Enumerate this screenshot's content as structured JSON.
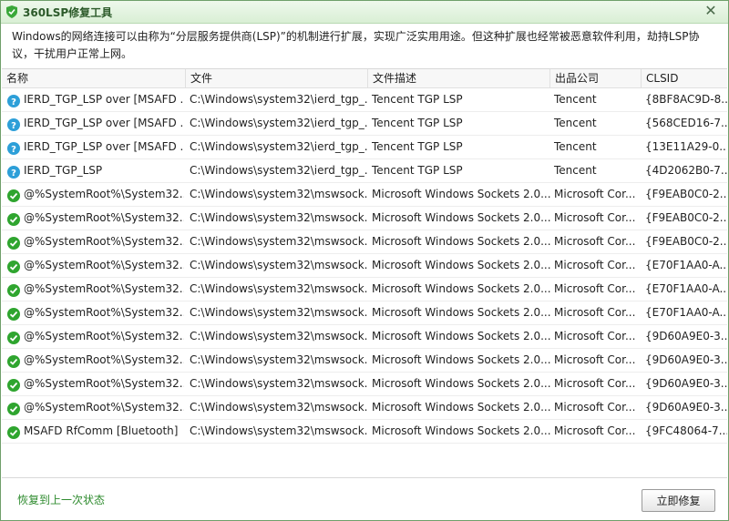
{
  "window": {
    "title": "360LSP修复工具",
    "close_label": "✕"
  },
  "description": "Windows的网络连接可以由称为“分层服务提供商(LSP)”的机制进行扩展，实现广泛实用用途。但这种扩展也经常被恶意软件利用，劫持LSP协议，干扰用户正常上网。",
  "columns": [
    "名称",
    "文件",
    "文件描述",
    "出品公司",
    "CLSID"
  ],
  "rows": [
    {
      "status": "info",
      "name": "IERD_TGP_LSP over [MSAFD ...",
      "file": "C:\\Windows\\system32\\ierd_tgp_...",
      "desc": "Tencent TGP LSP",
      "company": "Tencent",
      "clsid": "{8BF8AC9D-8..."
    },
    {
      "status": "info",
      "name": "IERD_TGP_LSP over [MSAFD ...",
      "file": "C:\\Windows\\system32\\ierd_tgp_...",
      "desc": "Tencent TGP LSP",
      "company": "Tencent",
      "clsid": "{568CED16-7..."
    },
    {
      "status": "info",
      "name": "IERD_TGP_LSP over [MSAFD ...",
      "file": "C:\\Windows\\system32\\ierd_tgp_...",
      "desc": "Tencent TGP LSP",
      "company": "Tencent",
      "clsid": "{13E11A29-0..."
    },
    {
      "status": "info",
      "name": "IERD_TGP_LSP",
      "file": "C:\\Windows\\system32\\ierd_tgp_...",
      "desc": "Tencent TGP LSP",
      "company": "Tencent",
      "clsid": "{4D2062B0-7..."
    },
    {
      "status": "ok",
      "name": "@%SystemRoot%\\System32...",
      "file": "C:\\Windows\\system32\\mswsock...",
      "desc": "Microsoft Windows Sockets 2.0...",
      "company": "Microsoft Cor...",
      "clsid": "{F9EAB0C0-2..."
    },
    {
      "status": "ok",
      "name": "@%SystemRoot%\\System32...",
      "file": "C:\\Windows\\system32\\mswsock...",
      "desc": "Microsoft Windows Sockets 2.0...",
      "company": "Microsoft Cor...",
      "clsid": "{F9EAB0C0-2..."
    },
    {
      "status": "ok",
      "name": "@%SystemRoot%\\System32...",
      "file": "C:\\Windows\\system32\\mswsock...",
      "desc": "Microsoft Windows Sockets 2.0...",
      "company": "Microsoft Cor...",
      "clsid": "{F9EAB0C0-2..."
    },
    {
      "status": "ok",
      "name": "@%SystemRoot%\\System32...",
      "file": "C:\\Windows\\system32\\mswsock...",
      "desc": "Microsoft Windows Sockets 2.0...",
      "company": "Microsoft Cor...",
      "clsid": "{E70F1AA0-A..."
    },
    {
      "status": "ok",
      "name": "@%SystemRoot%\\System32...",
      "file": "C:\\Windows\\system32\\mswsock...",
      "desc": "Microsoft Windows Sockets 2.0...",
      "company": "Microsoft Cor...",
      "clsid": "{E70F1AA0-A..."
    },
    {
      "status": "ok",
      "name": "@%SystemRoot%\\System32...",
      "file": "C:\\Windows\\system32\\mswsock...",
      "desc": "Microsoft Windows Sockets 2.0...",
      "company": "Microsoft Cor...",
      "clsid": "{E70F1AA0-A..."
    },
    {
      "status": "ok",
      "name": "@%SystemRoot%\\System32...",
      "file": "C:\\Windows\\system32\\mswsock...",
      "desc": "Microsoft Windows Sockets 2.0...",
      "company": "Microsoft Cor...",
      "clsid": "{9D60A9E0-3..."
    },
    {
      "status": "ok",
      "name": "@%SystemRoot%\\System32...",
      "file": "C:\\Windows\\system32\\mswsock...",
      "desc": "Microsoft Windows Sockets 2.0...",
      "company": "Microsoft Cor...",
      "clsid": "{9D60A9E0-3..."
    },
    {
      "status": "ok",
      "name": "@%SystemRoot%\\System32...",
      "file": "C:\\Windows\\system32\\mswsock...",
      "desc": "Microsoft Windows Sockets 2.0...",
      "company": "Microsoft Cor...",
      "clsid": "{9D60A9E0-3..."
    },
    {
      "status": "ok",
      "name": "@%SystemRoot%\\System32...",
      "file": "C:\\Windows\\system32\\mswsock...",
      "desc": "Microsoft Windows Sockets 2.0...",
      "company": "Microsoft Cor...",
      "clsid": "{9D60A9E0-3..."
    },
    {
      "status": "ok",
      "name": "MSAFD RfComm [Bluetooth]",
      "file": "C:\\Windows\\system32\\mswsock...",
      "desc": "Microsoft Windows Sockets 2.0...",
      "company": "Microsoft Cor...",
      "clsid": "{9FC48064-7..."
    }
  ],
  "footer": {
    "restore_link": "恢复到上一次状态",
    "repair_button": "立即修复"
  },
  "colors": {
    "ok": "#2fa52f",
    "info": "#2d9fd8",
    "accent": "#2e8b2e"
  },
  "icons": {
    "ok": "check-circle-icon",
    "info": "question-circle-icon",
    "app": "shield-icon",
    "close": "close-icon"
  }
}
